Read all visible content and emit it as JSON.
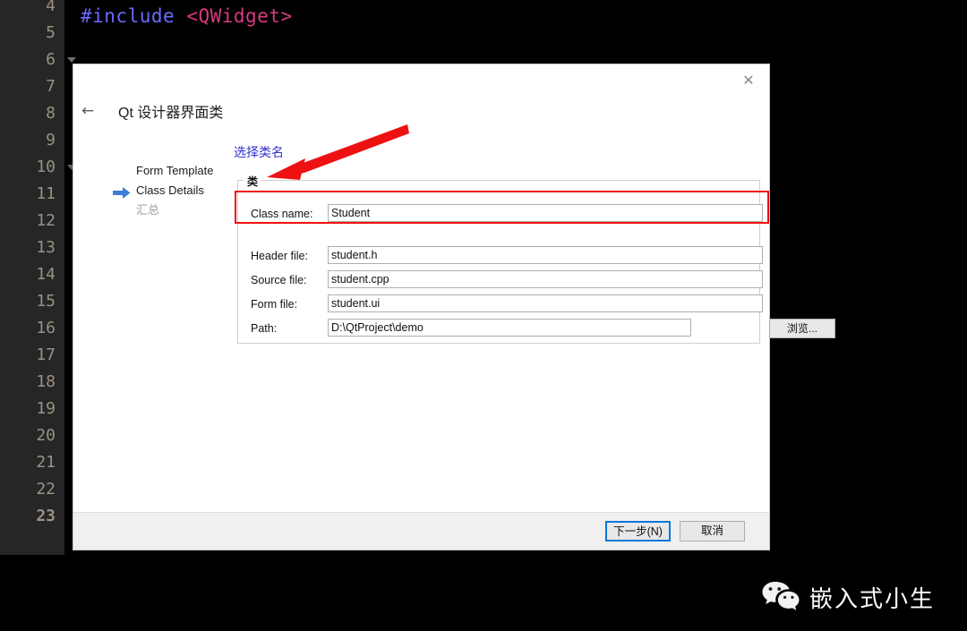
{
  "editor": {
    "line_numbers": [
      "4",
      "5",
      "6",
      "7",
      "8",
      "9",
      "10",
      "11",
      "12",
      "13",
      "14",
      "15",
      "16",
      "17",
      "18",
      "19",
      "20",
      "21",
      "22",
      "23"
    ],
    "current_line": "23",
    "code_preprocessor": "#include",
    "code_include": "<QWidget>",
    "colors": {
      "gutter_bg": "#262626",
      "code_bg": "#000000",
      "line_number": "#9a9184",
      "preprocessor": "#6a6aff",
      "include": "#d63a81"
    }
  },
  "dialog": {
    "title": "Qt 设计器界面类",
    "back_label": "←",
    "close_label": "✕",
    "steps": [
      {
        "label": "Form Template",
        "state": "done"
      },
      {
        "label": "Class Details",
        "state": "current"
      },
      {
        "label": "汇总",
        "state": "upcoming"
      }
    ],
    "group": {
      "legend": "类",
      "fields": [
        {
          "label": "Class name:",
          "value": "Student"
        },
        {
          "label": "Header file:",
          "value": "student.h"
        },
        {
          "label": "Source file:",
          "value": "student.cpp"
        },
        {
          "label": "Form file:",
          "value": "student.ui"
        },
        {
          "label": "Path:",
          "value": "D:\\QtProject\\demo"
        }
      ],
      "browse_label": "浏览..."
    },
    "footer": {
      "next_label": "下一步(N)",
      "cancel_label": "取消",
      "focus_color": "#0078d7"
    }
  },
  "annotations": {
    "callout_text": "选择类名",
    "callout_color": "#3333cc",
    "highlight_color": "#ee1111",
    "arrow_color": "#ee1111"
  },
  "watermark": {
    "text": "嵌入式小生",
    "icon": "wechat-icon"
  }
}
